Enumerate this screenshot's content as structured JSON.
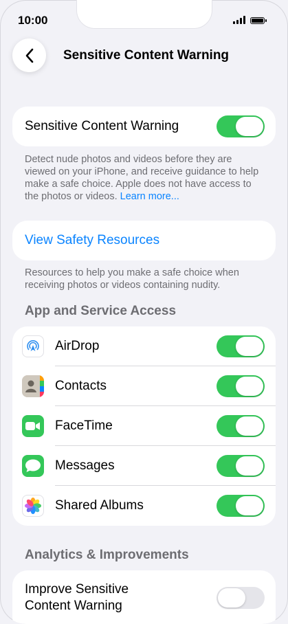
{
  "status_bar": {
    "time": "10:00"
  },
  "nav": {
    "title": "Sensitive Content Warning"
  },
  "main_toggle": {
    "label": "Sensitive Content Warning",
    "on": true
  },
  "description": {
    "text": "Detect nude photos and videos before they are viewed on your iPhone, and receive guidance to help make a safe choice. Apple does not have access to the photos or videos.",
    "link": "Learn more..."
  },
  "safety": {
    "link_label": "View Safety Resources",
    "footnote": "Resources to help you make a safe choice when receiving photos or videos containing nudity."
  },
  "app_access": {
    "header": "App and Service Access",
    "items": [
      {
        "label": "AirDrop",
        "icon": "airdrop-icon",
        "on": true
      },
      {
        "label": "Contacts",
        "icon": "contacts-icon",
        "on": true
      },
      {
        "label": "FaceTime",
        "icon": "facetime-icon",
        "on": true
      },
      {
        "label": "Messages",
        "icon": "messages-icon",
        "on": true
      },
      {
        "label": "Shared Albums",
        "icon": "photos-icon",
        "on": true
      }
    ]
  },
  "analytics": {
    "header": "Analytics & Improvements",
    "improve_label_line1": "Improve Sensitive",
    "improve_label_line2": "Content Warning",
    "improve_on": false
  },
  "colors": {
    "toggle_on": "#34c759",
    "link": "#0a84ff",
    "background": "#f2f2f7"
  }
}
